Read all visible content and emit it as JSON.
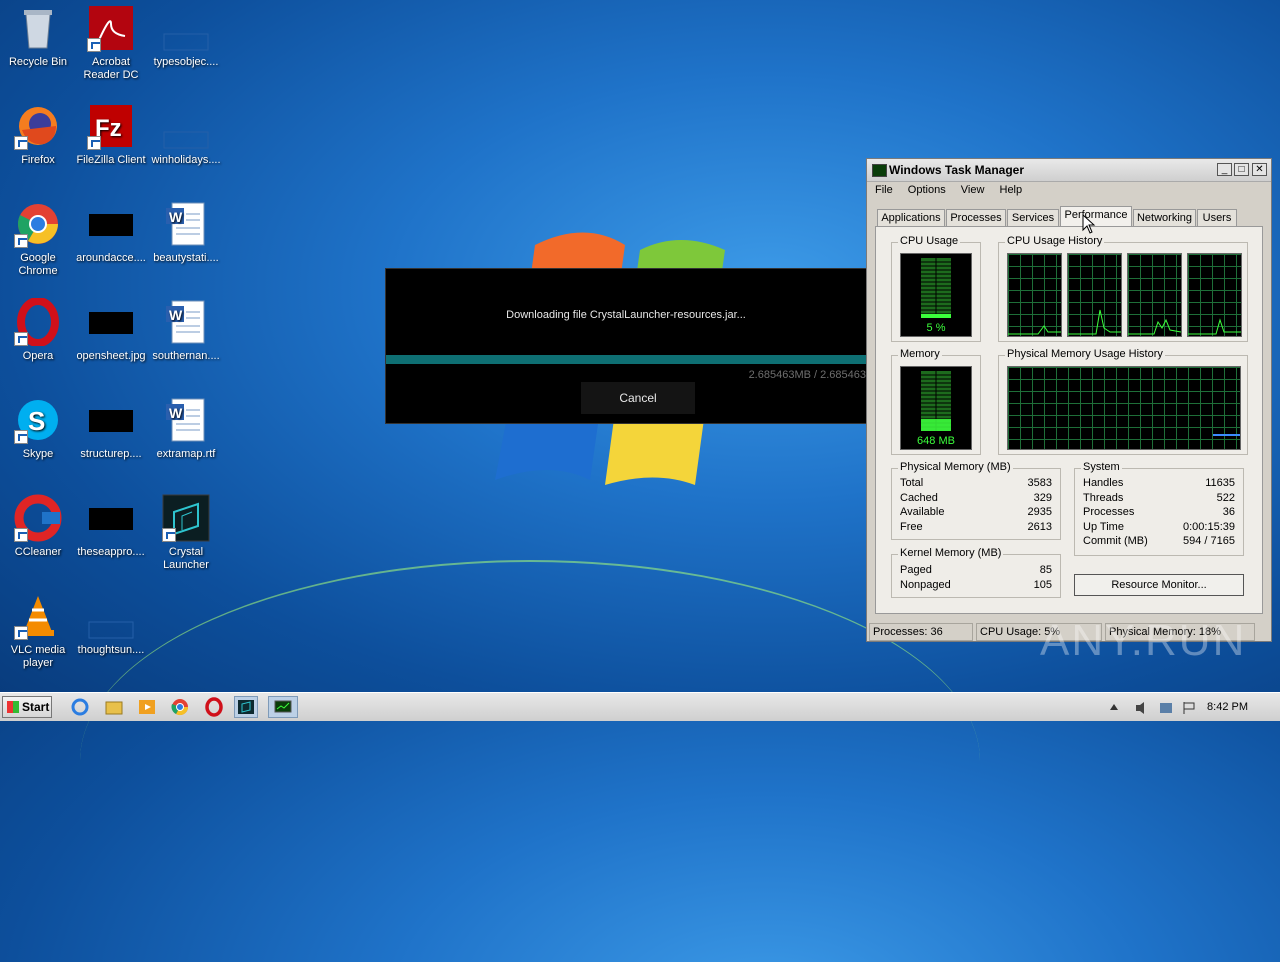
{
  "desktop_icons": [
    {
      "label": "Recycle Bin",
      "icon": "recycle-bin-icon"
    },
    {
      "label": "Acrobat Reader DC",
      "icon": "acrobat-icon"
    },
    {
      "label": "typesobjec....",
      "icon": "blank-file-icon"
    },
    {
      "label": "Firefox",
      "icon": "firefox-icon"
    },
    {
      "label": "FileZilla Client",
      "icon": "filezilla-icon"
    },
    {
      "label": "winholidays....",
      "icon": "blank-file-icon"
    },
    {
      "label": "Google Chrome",
      "icon": "chrome-icon"
    },
    {
      "label": "aroundacce....",
      "icon": "black-thumbnail-icon"
    },
    {
      "label": "beautystati....",
      "icon": "word-doc-icon"
    },
    {
      "label": "Opera",
      "icon": "opera-icon"
    },
    {
      "label": "opensheet.jpg",
      "icon": "black-thumbnail-icon"
    },
    {
      "label": "southernan....",
      "icon": "word-doc-icon"
    },
    {
      "label": "Skype",
      "icon": "skype-icon"
    },
    {
      "label": "structurep....",
      "icon": "black-thumbnail-icon"
    },
    {
      "label": "extramap.rtf",
      "icon": "word-doc-icon"
    },
    {
      "label": "CCleaner",
      "icon": "ccleaner-icon"
    },
    {
      "label": "theseappro....",
      "icon": "black-thumbnail-icon"
    },
    {
      "label": "Crystal Launcher",
      "icon": "crystal-launcher-icon"
    },
    {
      "label": "VLC media player",
      "icon": "vlc-icon"
    },
    {
      "label": "thoughtsun....",
      "icon": "blank-file-icon"
    }
  ],
  "download_dialog": {
    "message": "Downloading file CrystalLauncher-resources.jar...",
    "progress": 1.0,
    "bytes": "2.685463MB / 2.685463",
    "cancel": "Cancel"
  },
  "task_manager": {
    "title": "Windows Task Manager",
    "menu": [
      "File",
      "Options",
      "View",
      "Help"
    ],
    "tabs": [
      "Applications",
      "Processes",
      "Services",
      "Performance",
      "Networking",
      "Users"
    ],
    "active_tab": "Performance",
    "cpu_usage_label": "CPU Usage",
    "cpu_usage_value": "5 %",
    "cpu_history_label": "CPU Usage History",
    "memory_label": "Memory",
    "memory_value": "648 MB",
    "phys_history_label": "Physical Memory Usage History",
    "physical_memory": {
      "caption": "Physical Memory (MB)",
      "rows": [
        {
          "k": "Total",
          "v": "3583"
        },
        {
          "k": "Cached",
          "v": "329"
        },
        {
          "k": "Available",
          "v": "2935"
        },
        {
          "k": "Free",
          "v": "2613"
        }
      ]
    },
    "kernel_memory": {
      "caption": "Kernel Memory (MB)",
      "rows": [
        {
          "k": "Paged",
          "v": "85"
        },
        {
          "k": "Nonpaged",
          "v": "105"
        }
      ]
    },
    "system": {
      "caption": "System",
      "rows": [
        {
          "k": "Handles",
          "v": "11635"
        },
        {
          "k": "Threads",
          "v": "522"
        },
        {
          "k": "Processes",
          "v": "36"
        },
        {
          "k": "Up Time",
          "v": "0:00:15:39"
        },
        {
          "k": "Commit (MB)",
          "v": "594 / 7165"
        }
      ]
    },
    "resource_monitor": "Resource Monitor...",
    "status": {
      "processes": "Processes: 36",
      "cpu": "CPU Usage: 5%",
      "memory": "Physical Memory: 18%"
    }
  },
  "taskbar": {
    "start": "Start",
    "items": [
      "ie-icon",
      "explorer-icon",
      "media-player-icon",
      "chrome-icon",
      "opera-icon",
      "crystal-launcher-icon",
      "task-manager-icon"
    ],
    "clock": "8:42 PM"
  },
  "watermark": "ANY.RUN"
}
